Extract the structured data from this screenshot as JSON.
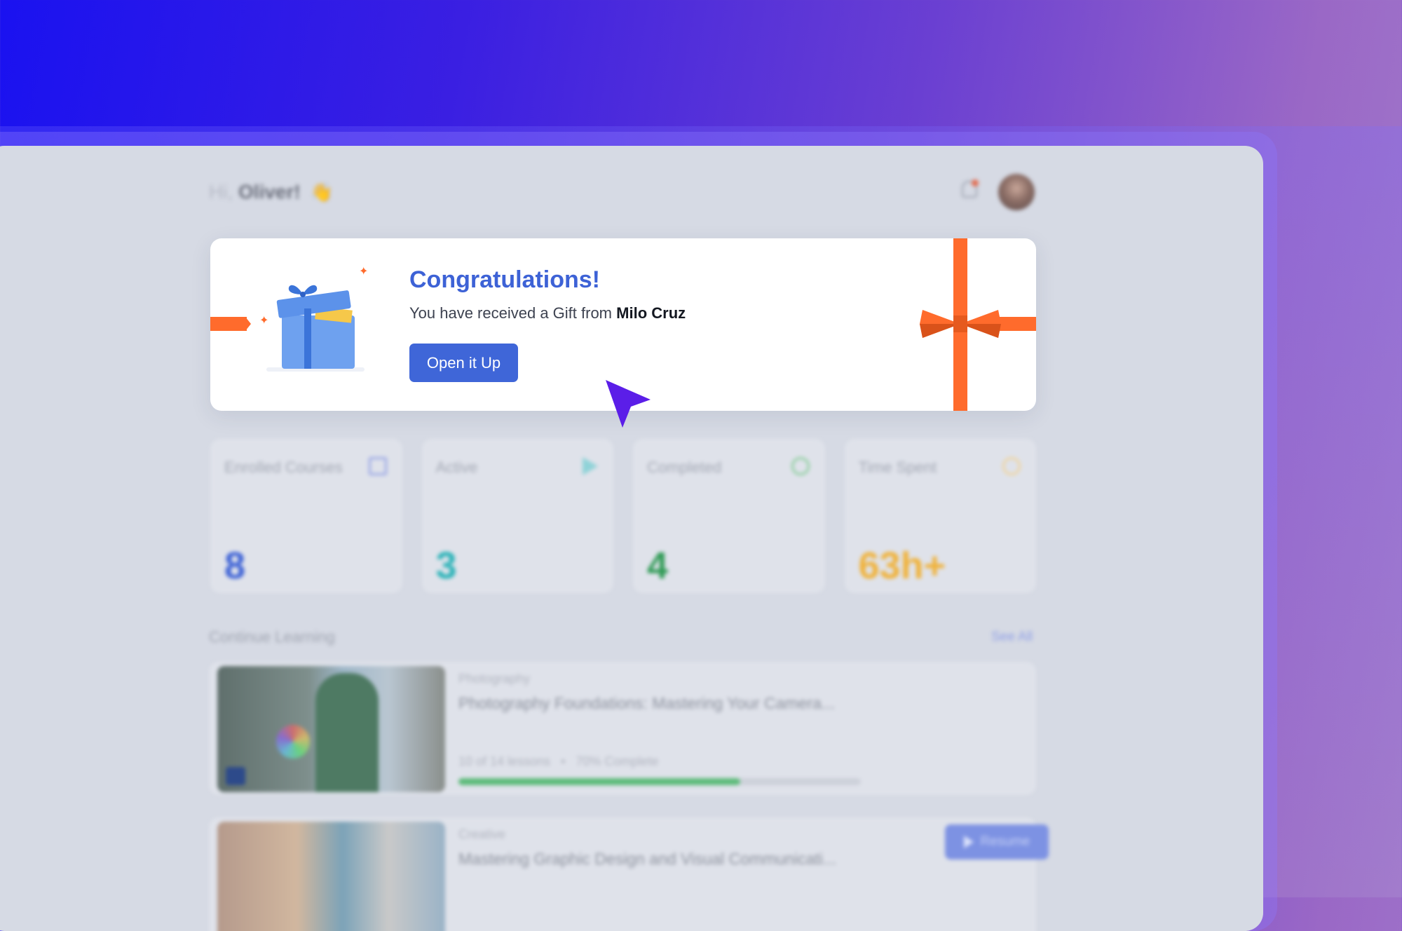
{
  "header": {
    "greeting_prefix": "Hi,",
    "user_name": "Oliver!",
    "wave_emoji": "👋"
  },
  "gift": {
    "title": "Congratulations!",
    "message_prefix": "You have received a Gift from",
    "sender": "Milo Cruz",
    "button_label": "Open it Up"
  },
  "stats": [
    {
      "label": "Enrolled Courses",
      "value": "8",
      "icon": "book-icon",
      "color": "#3d62d6"
    },
    {
      "label": "Active",
      "value": "3",
      "icon": "play-icon",
      "color": "#2bb3b8"
    },
    {
      "label": "Completed",
      "value": "4",
      "icon": "check-circle-icon",
      "color": "#2f9a55"
    },
    {
      "label": "Time Spent",
      "value": "63h+",
      "icon": "clock-icon",
      "color": "#f0b23a"
    }
  ],
  "continue_learning": {
    "title": "Continue Learning",
    "see_all": "See All",
    "courses": [
      {
        "category": "Photography",
        "title": "Photography Foundations: Mastering Your Camera...",
        "lessons": "10 of 14 lessons",
        "separator": "•",
        "complete": "70% Complete",
        "progress": 0.7
      },
      {
        "category": "Creative",
        "title": "Mastering Graphic Design and Visual Communicati...",
        "resume_label": "Resume"
      }
    ]
  },
  "colors": {
    "accent": "#3f66d8",
    "ribbon": "#ff6b2c",
    "cursor": "#5b1ee8"
  }
}
